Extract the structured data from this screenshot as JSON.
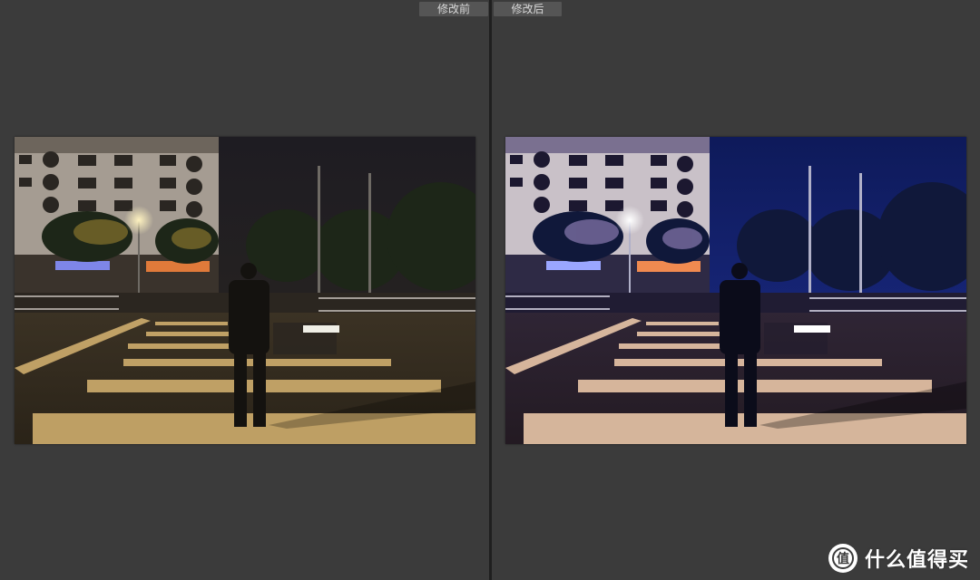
{
  "compare": {
    "before_label": "修改前",
    "after_label": "修改后"
  },
  "watermark": {
    "text": "什么值得买",
    "icon": "zhi-logo-icon"
  },
  "colors": {
    "background": "#3b3b3b",
    "label_bg": "#555555",
    "divider": "#1f1f1f"
  }
}
